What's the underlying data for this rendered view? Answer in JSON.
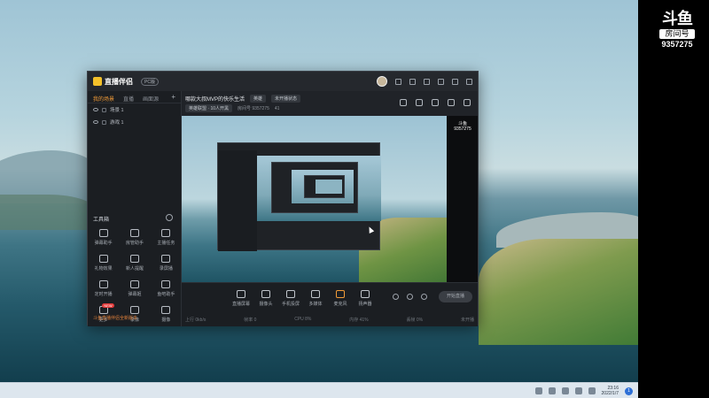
{
  "app": {
    "name": "直播伴侣",
    "version_badge": "PC版",
    "stream_title": "哪款大叔MVP的快乐生活",
    "category_pill": "英雄",
    "status_pill": "未开播状态",
    "meta_category": "英雄联盟 · 10人开黑",
    "meta_room": "房间号 9357275",
    "meta_viewers": "41"
  },
  "left_panel": {
    "tabs": [
      {
        "label": "我的场景"
      },
      {
        "label": "直播"
      },
      {
        "label": "画面源"
      }
    ],
    "add_label": "+",
    "scenes": [
      {
        "label": "场景 1"
      },
      {
        "label": "游戏 1"
      }
    ],
    "toolbox_title": "工具箱",
    "tools": [
      {
        "label": "弹幕助手"
      },
      {
        "label": "房管助手"
      },
      {
        "label": "主播任务"
      },
      {
        "label": "礼物效果"
      },
      {
        "label": "新人提醒"
      },
      {
        "label": "录屏播"
      },
      {
        "label": "定时开播"
      },
      {
        "label": "弹幕姬"
      },
      {
        "label": "鱼吧助手"
      },
      {
        "label": "更多",
        "badge": "NEW"
      },
      {
        "label": "录像"
      },
      {
        "label": "摄像"
      }
    ],
    "bottom_notice": "斗鱼直播伴侣全新版本"
  },
  "bottom_bar": {
    "items": [
      {
        "label": "直播屏幕"
      },
      {
        "label": "摄像头"
      },
      {
        "label": "手机投屏"
      },
      {
        "label": "多媒体"
      },
      {
        "label": "麦克风"
      },
      {
        "label": "扬声器"
      }
    ],
    "start_label": "开始直播",
    "status_items": [
      "上行 0kb/s",
      "帧率 0",
      "CPU 8%",
      "内存 41%",
      "丢帧 0%",
      "未开播"
    ]
  },
  "preview": {
    "mini_logo": "斗鱼",
    "mini_room": "9357275"
  },
  "side_brand": {
    "logo": "斗鱼",
    "room_label": "房间号",
    "room_number": "9357275"
  },
  "taskbar": {
    "time": "23:16",
    "date": "2022/1/7",
    "notification_count": "1"
  }
}
